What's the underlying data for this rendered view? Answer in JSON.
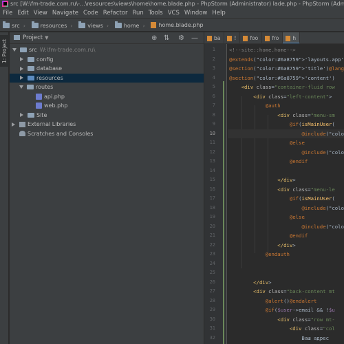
{
  "window": {
    "title": "src [W:\\fm-trade.com.ru\\-...\\resources\\views\\home\\home.blade.php - PhpStorm (Administrator) lade.php - PhpStorm (Administrator)"
  },
  "menu": [
    "File",
    "Edit",
    "View",
    "Navigate",
    "Code",
    "Refactor",
    "Run",
    "Tools",
    "VCS",
    "Window",
    "Help"
  ],
  "breadcrumbs": [
    "src",
    "resources",
    "views",
    "home",
    "home.blade.php"
  ],
  "tool_window": {
    "vertical_tab": "1: Project",
    "title": "Project",
    "tools": [
      "target-icon",
      "collapse-icon",
      "gear-icon",
      "hide-icon"
    ]
  },
  "tree": [
    {
      "label": "src",
      "hint": "W:\\fm-trade.com.ru\\",
      "state": "open",
      "icon": "folder"
    },
    {
      "label": "config",
      "state": "closed",
      "icon": "folder"
    },
    {
      "label": "database",
      "state": "closed",
      "icon": "folder"
    },
    {
      "label": "resources",
      "state": "closed",
      "icon": "folder",
      "selected": true
    },
    {
      "label": "routes",
      "state": "open",
      "icon": "folder"
    },
    {
      "label": "api.php",
      "state": "leaf",
      "icon": "php"
    },
    {
      "label": "web.php",
      "state": "leaf",
      "icon": "php"
    },
    {
      "label": "Site",
      "state": "closed",
      "icon": "folder"
    },
    {
      "label": "External Libraries",
      "state": "closed",
      "icon": "library"
    },
    {
      "label": "Scratches and Consoles",
      "state": "leaf",
      "icon": "scratches"
    }
  ],
  "editor_tabs": [
    {
      "label": "ba",
      "active": false
    },
    {
      "label": "!",
      "active": false
    },
    {
      "label": "foo",
      "active": false
    },
    {
      "label": "fro",
      "active": false
    },
    {
      "label": "h",
      "active": true
    }
  ],
  "code_lines": [
    {
      "n": "1",
      "text": "<!--site::home.home-->"
    },
    {
      "n": "2",
      "text": "@extends('layouts.app')"
    },
    {
      "n": "3",
      "text": "@section('title')@lang('site::messa"
    },
    {
      "n": "4",
      "text": "@section('content')"
    },
    {
      "n": "5",
      "text": "    <div class=\"container-fluid row"
    },
    {
      "n": "6",
      "text": "        <div class=\"left-content\">"
    },
    {
      "n": "7",
      "text": "            @auth"
    },
    {
      "n": "8",
      "text": "                <div class=\"menu-sm"
    },
    {
      "n": "9",
      "text": "                    @if(isMainUser("
    },
    {
      "n": "10",
      "text": "                        @include('s"
    },
    {
      "n": "11",
      "text": "                    @else"
    },
    {
      "n": "12",
      "text": "                        @include('s"
    },
    {
      "n": "13",
      "text": "                    @endif"
    },
    {
      "n": "14",
      "text": ""
    },
    {
      "n": "15",
      "text": "                </div>"
    },
    {
      "n": "16",
      "text": "                <div class=\"menu-le"
    },
    {
      "n": "17",
      "text": "                    @if(isMainUser("
    },
    {
      "n": "18",
      "text": "                        @include('s"
    },
    {
      "n": "19",
      "text": "                    @else"
    },
    {
      "n": "20",
      "text": "                        @include('s"
    },
    {
      "n": "21",
      "text": "                    @endif"
    },
    {
      "n": "22",
      "text": "                </div>"
    },
    {
      "n": "23",
      "text": "            @endauth"
    },
    {
      "n": "24",
      "text": ""
    },
    {
      "n": "25",
      "text": ""
    },
    {
      "n": "26",
      "text": "        </div>"
    },
    {
      "n": "27",
      "text": "        <div class=\"back-content mt"
    },
    {
      "n": "28",
      "text": "            @alert()@endalert"
    },
    {
      "n": "29",
      "text": "            @if($user->email && !$u"
    },
    {
      "n": "30",
      "text": "                <div class=\"row mt-"
    },
    {
      "n": "31",
      "text": "                    <div class=\"col"
    },
    {
      "n": "32",
      "text": "                        Ваш адрес"
    }
  ],
  "colors": {
    "background": "#2b2b2b",
    "panel": "#3c3f41",
    "selection": "#0d293e",
    "accent": "#4a88c7",
    "keyword": "#cc7832",
    "string": "#6a8759",
    "tag": "#e8bf6a",
    "blade": "#bbb529",
    "function": "#ffc66d",
    "variable": "#9876aa",
    "comment": "#808080"
  }
}
